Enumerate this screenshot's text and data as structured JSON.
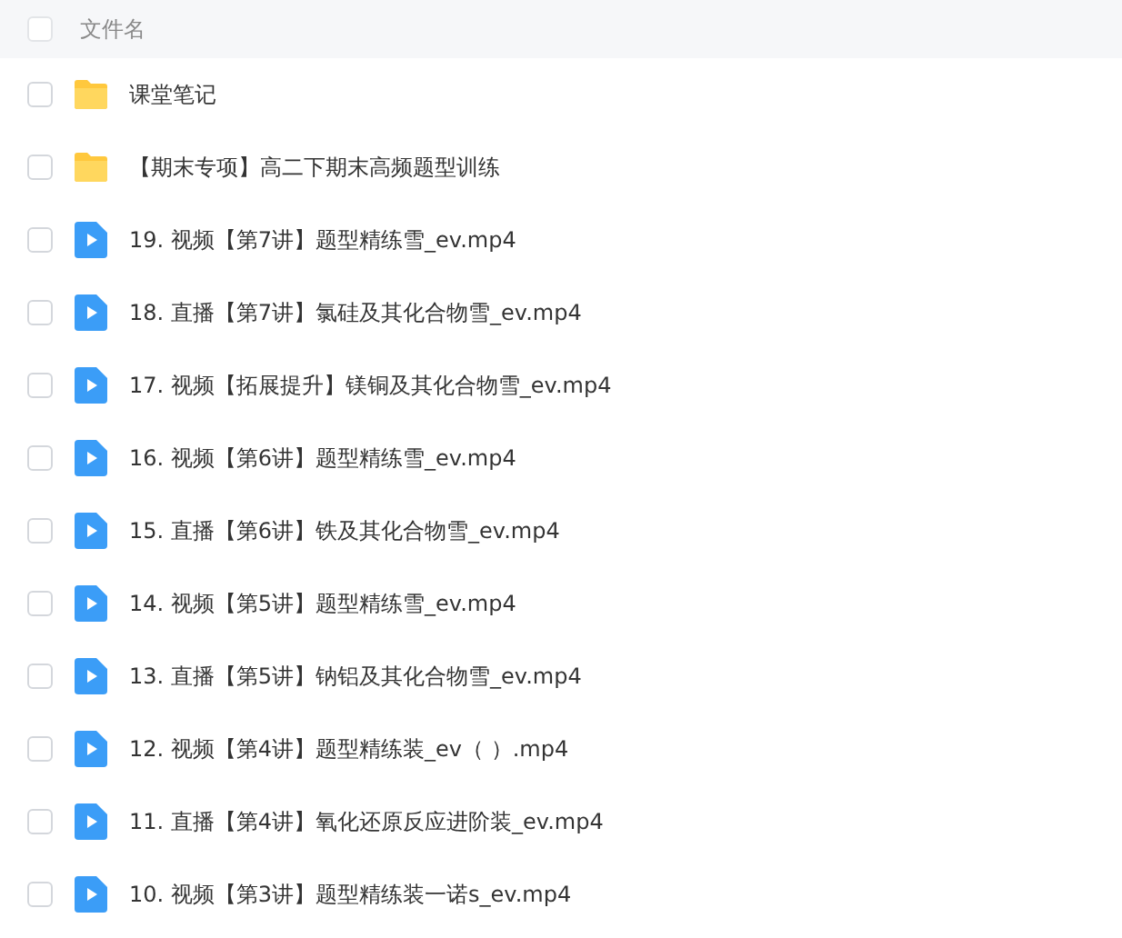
{
  "header": {
    "checked": false,
    "label": "文件名"
  },
  "files": [
    {
      "kind": "folder",
      "checked": false,
      "name": "课堂笔记"
    },
    {
      "kind": "folder",
      "checked": false,
      "name": "【期末专项】高二下期末高频题型训练"
    },
    {
      "kind": "video",
      "checked": false,
      "name": "19. 视频【第7讲】题型精练雪_ev.mp4"
    },
    {
      "kind": "video",
      "checked": false,
      "name": "18. 直播【第7讲】氯硅及其化合物雪_ev.mp4"
    },
    {
      "kind": "video",
      "checked": false,
      "name": "17. 视频【拓展提升】镁铜及其化合物雪_ev.mp4"
    },
    {
      "kind": "video",
      "checked": false,
      "name": "16. 视频【第6讲】题型精练雪_ev.mp4"
    },
    {
      "kind": "video",
      "checked": false,
      "name": "15. 直播【第6讲】铁及其化合物雪_ev.mp4"
    },
    {
      "kind": "video",
      "checked": false,
      "name": "14. 视频【第5讲】题型精练雪_ev.mp4"
    },
    {
      "kind": "video",
      "checked": false,
      "name": "13. 直播【第5讲】钠铝及其化合物雪_ev.mp4"
    },
    {
      "kind": "video",
      "checked": false,
      "name": "12. 视频【第4讲】题型精练装_ev（ ）.mp4"
    },
    {
      "kind": "video",
      "checked": false,
      "name": "11. 直播【第4讲】氧化还原反应进阶装_ev.mp4"
    },
    {
      "kind": "video",
      "checked": false,
      "name": "10. 视频【第3讲】题型精练装一诺s_ev.mp4"
    }
  ]
}
